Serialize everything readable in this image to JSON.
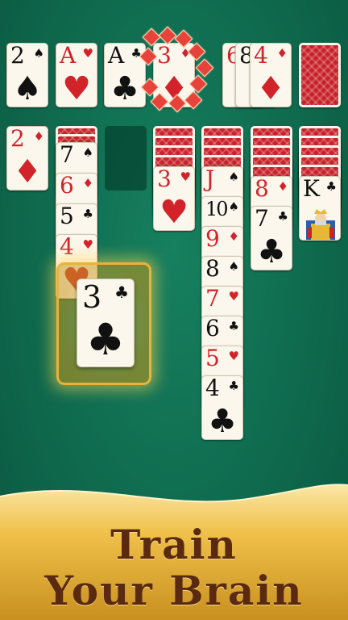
{
  "foundations": [
    {
      "rank": "2",
      "suit": "♠",
      "color": "black"
    },
    {
      "rank": "A",
      "suit": "♥",
      "color": "red"
    },
    {
      "rank": "A",
      "suit": "♣",
      "color": "black"
    },
    {
      "rank": "3",
      "suit": "♦",
      "color": "red"
    }
  ],
  "waste": [
    {
      "rank": "6",
      "suit": "♦",
      "color": "red"
    },
    {
      "rank": "8",
      "suit": "♣",
      "color": "black"
    },
    {
      "rank": "4",
      "suit": "♦",
      "color": "red"
    }
  ],
  "tableau": {
    "col1": [
      {
        "rank": "2",
        "suit": "♦",
        "color": "red"
      }
    ],
    "col2": [
      {
        "rank": "7",
        "suit": "♠",
        "color": "black"
      },
      {
        "rank": "6",
        "suit": "♦",
        "color": "red"
      },
      {
        "rank": "5",
        "suit": "♣",
        "color": "black"
      },
      {
        "rank": "4",
        "suit": "♥",
        "color": "red"
      }
    ],
    "col4": [
      {
        "rank": "3",
        "suit": "♥",
        "color": "red"
      }
    ],
    "col5": [
      {
        "rank": "J",
        "suit": "♠",
        "color": "red"
      },
      {
        "rank": "10",
        "suit": "♠",
        "color": "black"
      },
      {
        "rank": "9",
        "suit": "♦",
        "color": "red"
      },
      {
        "rank": "8",
        "suit": "♠",
        "color": "black"
      },
      {
        "rank": "7",
        "suit": "♥",
        "color": "red"
      },
      {
        "rank": "6",
        "suit": "♣",
        "color": "black"
      },
      {
        "rank": "5",
        "suit": "♥",
        "color": "red"
      },
      {
        "rank": "4",
        "suit": "♣",
        "color": "black"
      }
    ],
    "col6": [
      {
        "rank": "8",
        "suit": "♦",
        "color": "red"
      },
      {
        "rank": "7",
        "suit": "♣",
        "color": "black"
      }
    ],
    "col7": [
      {
        "rank": "K",
        "suit": "♣",
        "color": "black"
      }
    ]
  },
  "dragged_card": {
    "rank": "3",
    "suit": "♣",
    "color": "black"
  },
  "banner": {
    "line1": "Train",
    "line2": "Your Brain"
  },
  "colors": {
    "felt": "#0f6a4e",
    "card_back": "#c8232b",
    "highlight": "#e8b33a",
    "banner_gold": "#f0c14b",
    "banner_text": "#5a2a10"
  }
}
